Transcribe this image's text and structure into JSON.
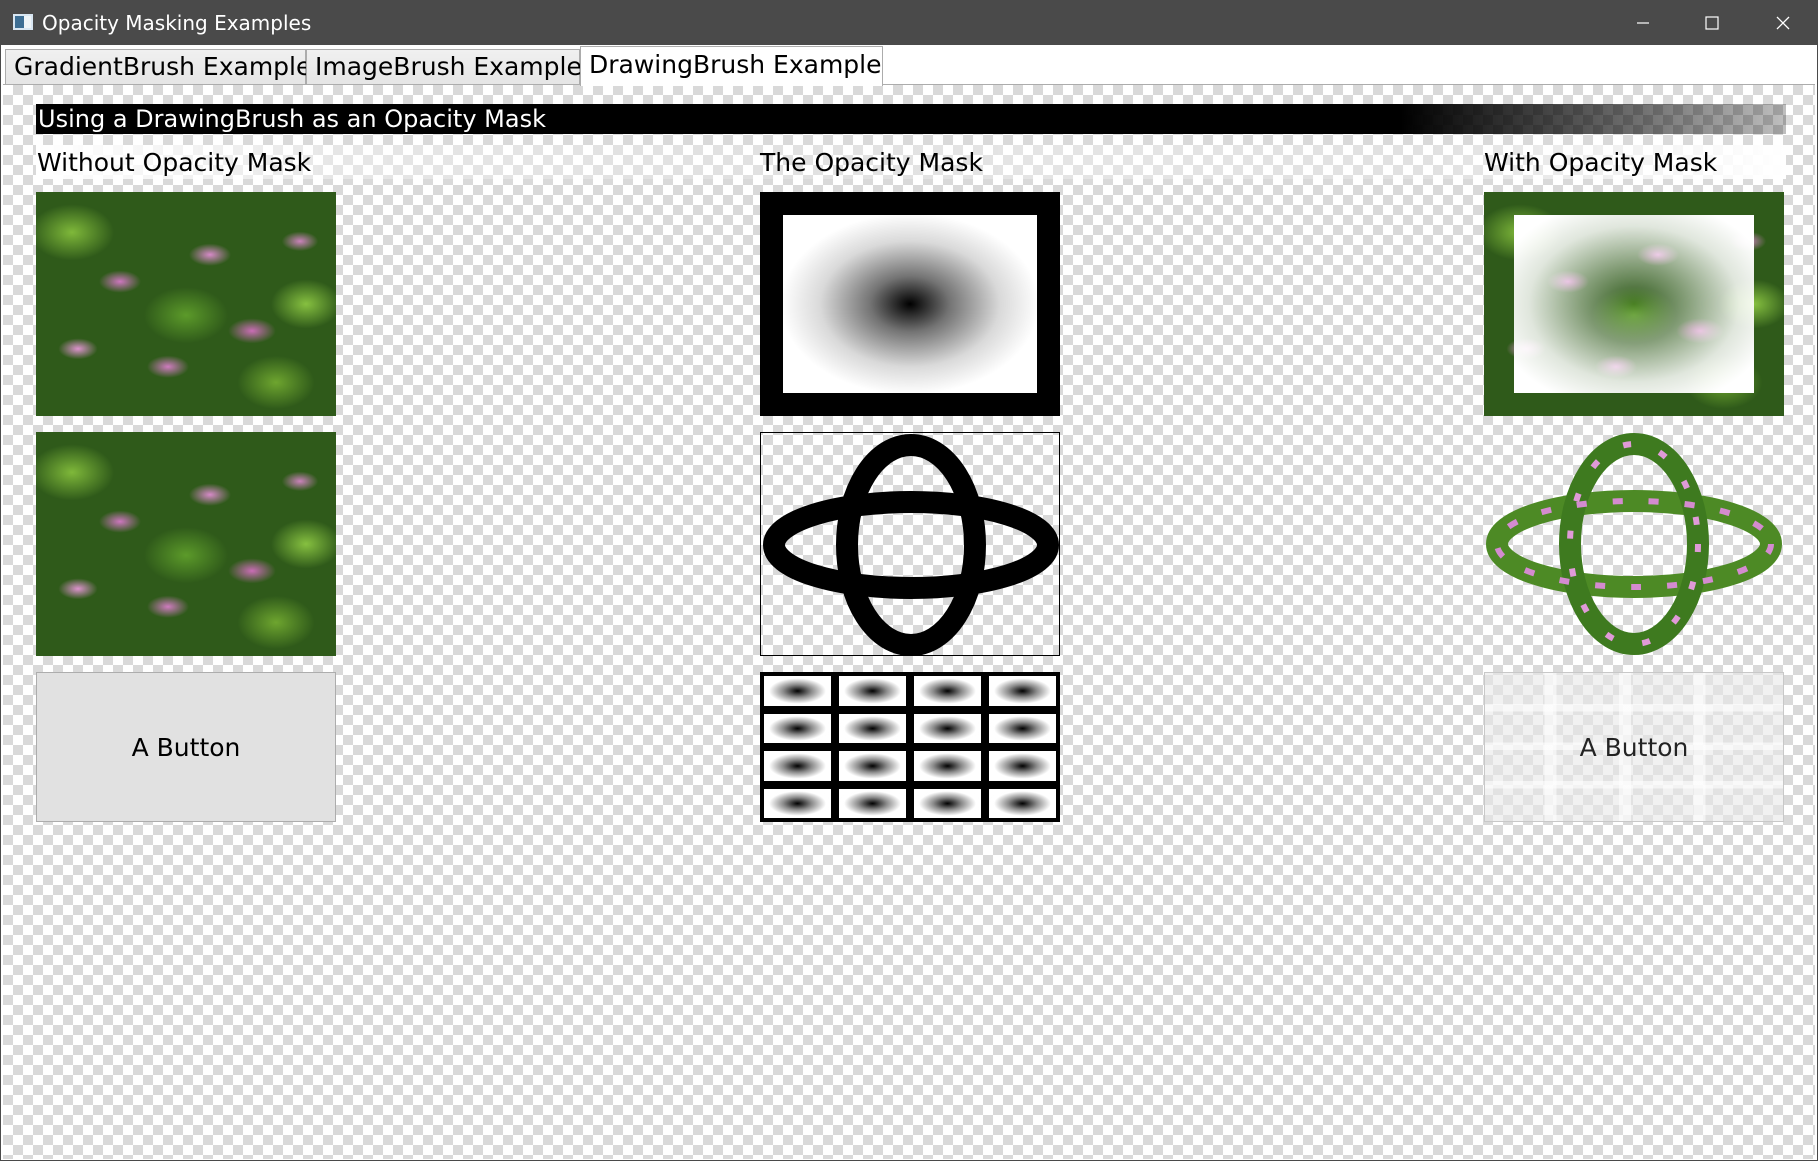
{
  "window": {
    "title": "Opacity Masking Examples",
    "icon": "app-window-icon",
    "controls": [
      "minimize-icon",
      "maximize-icon",
      "close-icon"
    ]
  },
  "tabs": [
    {
      "label": "GradientBrush Example",
      "selected": false
    },
    {
      "label": "ImageBrush Example",
      "selected": false
    },
    {
      "label": "DrawingBrush Example",
      "selected": true
    }
  ],
  "content": {
    "heading": "Using a DrawingBrush as an Opacity Mask",
    "columns": [
      {
        "label": "Without Opacity Mask"
      },
      {
        "label": "The Opacity Mask"
      },
      {
        "label": "With Opacity Mask"
      }
    ],
    "button_label": "A Button",
    "masked_button_label": "A Button"
  },
  "colors": {
    "titlebar": "#4a4a4a",
    "checker_light": "#ffffff",
    "checker_dark": "#d9d9d9",
    "button_face": "#e1e1e1"
  }
}
